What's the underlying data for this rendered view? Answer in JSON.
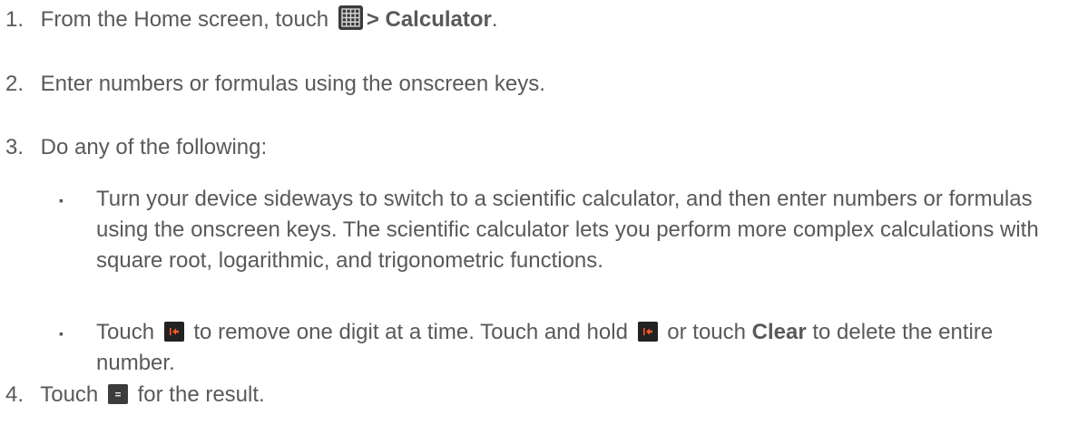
{
  "steps": [
    {
      "num": "1.",
      "pre": "From the Home screen, touch",
      "icon": "apps-grid-icon",
      "bold": "> Calculator",
      "post": "."
    },
    {
      "num": "2.",
      "text": "Enter numbers or formulas using the onscreen keys."
    },
    {
      "num": "3.",
      "text": "Do any of the following:"
    },
    {
      "num": "4.",
      "pre": "Touch",
      "icon": "equals-key-icon",
      "post": "for the result."
    }
  ],
  "bullets": [
    {
      "marker": "▪",
      "text": "Turn your device sideways to switch to a scientific calculator, and then enter numbers or formulas using the onscreen keys. The scientific calculator lets you perform more complex calculations with square root, logarithmic, and trigonometric functions."
    },
    {
      "marker": "▪",
      "seg1": "Touch",
      "seg2": "to remove one digit at a time. Touch and hold",
      "seg3": "or touch",
      "bold": "Clear",
      "seg4": "to delete the entire number."
    }
  ]
}
